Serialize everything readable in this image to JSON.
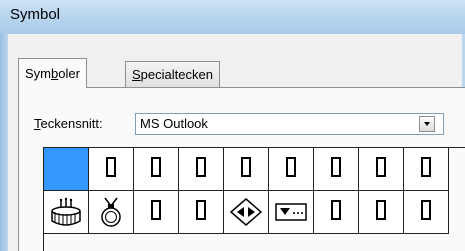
{
  "window": {
    "title": "Symbol"
  },
  "tabs": [
    {
      "label_pre": "Sym",
      "label_u": "b",
      "label_post": "oler",
      "active": true
    },
    {
      "label_pre": "",
      "label_u": "S",
      "label_post": "pecialtecken",
      "active": false
    }
  ],
  "font": {
    "label_u": "T",
    "label_rest": "eckensnitt:",
    "value": "MS Outlook"
  },
  "symbols": {
    "row1": [
      "selected",
      "box",
      "box",
      "box",
      "box",
      "box",
      "box",
      "box",
      "box"
    ],
    "row2": [
      "drum-icon",
      "medal-icon",
      "box",
      "box",
      "diamond-arrows-icon",
      "envelope-tray-icon",
      "box",
      "box",
      "box"
    ]
  }
}
